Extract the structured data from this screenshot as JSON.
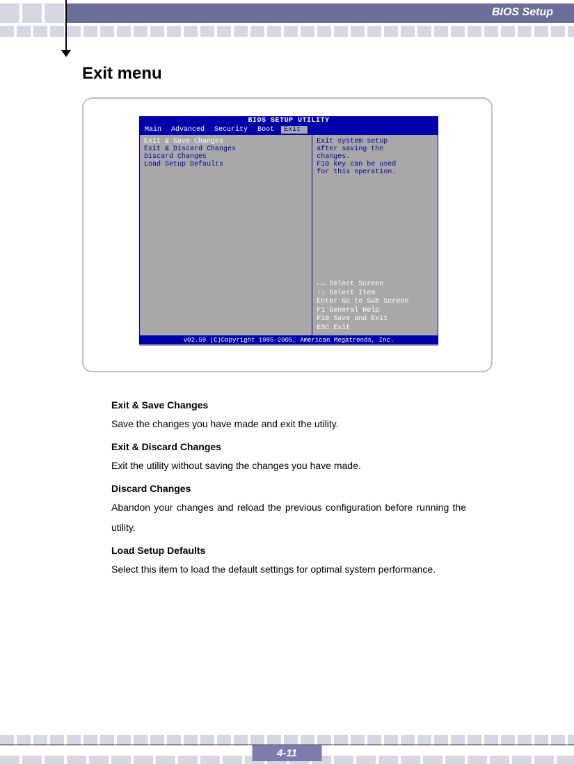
{
  "header": {
    "chapter": "BIOS Setup"
  },
  "title": "Exit menu",
  "bios": {
    "title": "BIOS SETUP UTILITY",
    "menu": [
      "Main",
      "Advanced",
      "Security",
      "Boot",
      "Exit"
    ],
    "menu_selected": "Exit",
    "items": [
      "Exit & Save Changes",
      "Exit & Discard Changes",
      "Discard Changes",
      "",
      "Load Setup Defaults"
    ],
    "help": [
      "Exit system setup",
      "after saving the",
      "changes.",
      "",
      "F10 key can be used",
      "for this operation."
    ],
    "nav": [
      "←→    Select Screen",
      "↑↓    Select Item",
      "Enter Go to Sub Screen",
      "F1    General Help",
      "F10   Save and Exit",
      "ESC   Exit"
    ],
    "footer": "v02.59 (C)Copyright 1985-2005, American Megatrends, Inc."
  },
  "sections": [
    {
      "heading": "Exit & Save Changes",
      "body": "Save the changes you have made and exit the utility."
    },
    {
      "heading": "Exit & Discard Changes",
      "body": "Exit the utility without saving the changes you have made."
    },
    {
      "heading": "Discard Changes",
      "body": "Abandon your changes and reload the previous configuration before running the utility."
    },
    {
      "heading": "Load Setup Defaults",
      "body": "Select this item to load the default settings for optimal system performance."
    }
  ],
  "page_number": "4-11"
}
